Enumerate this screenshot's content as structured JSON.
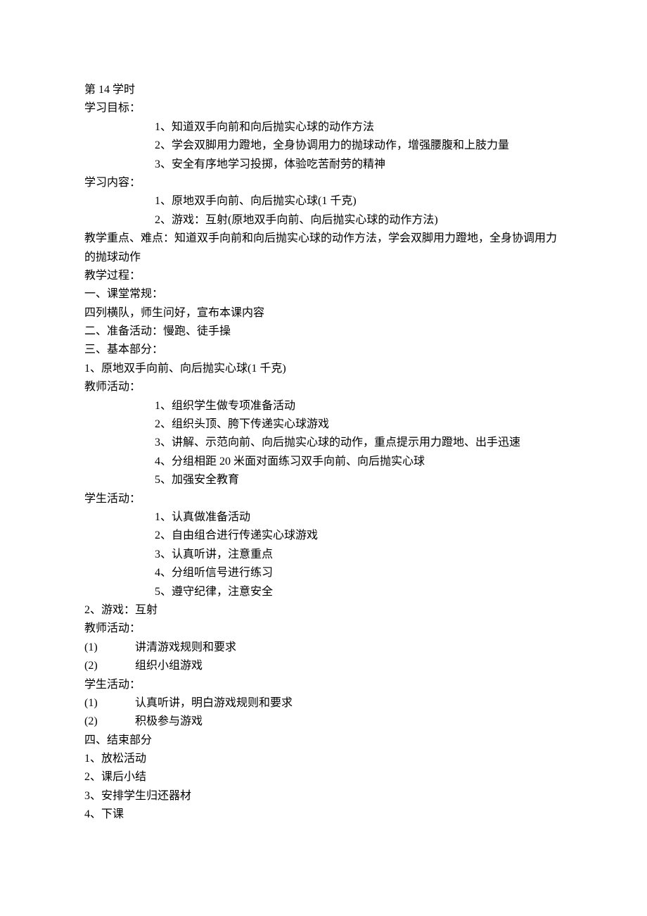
{
  "lesson_number": "第 14 学时",
  "goals_label": "学习目标：",
  "goals": [
    "1、知道双手向前和向后抛实心球的动作方法",
    "2、学会双脚用力蹬地，全身协调用力的抛球动作，增强腰腹和上肢力量",
    "3、安全有序地学习投掷，体验吃苦耐劳的精神"
  ],
  "content_label": "学习内容：",
  "content": [
    "1、原地双手向前、向后抛实心球(1 千克)",
    "2、游戏：互射(原地双手向前、向后抛实心球的动作方法)"
  ],
  "key_points": "教学重点、难点：知道双手向前和向后抛实心球的动作方法，学会双脚用力蹬地，全身协调用力的抛球动作",
  "process_label": "教学过程：",
  "section1_label": "一、课堂常规：",
  "section1_text": "四列横队，师生问好，宣布本课内容",
  "section2_label": "二、准备活动：慢跑、徒手操",
  "section3_label": "三、基本部分：",
  "part1_label": "1、原地双手向前、向后抛实心球(1 千克)",
  "teacher_act_label": "教师活动：",
  "teacher_acts1": [
    "1、组织学生做专项准备活动",
    "2、组织头顶、胯下传递实心球游戏",
    "3、讲解、示范向前、向后抛实心球的动作，重点提示用力蹬地、出手迅速",
    "4、分组相距 20 米面对面练习双手向前、向后抛实心球",
    "5、加强安全教育"
  ],
  "student_act_label": "学生活动：",
  "student_acts1": [
    "1、认真做准备活动",
    "2、自由组合进行传递实心球游戏",
    "3、认真听讲，注意重点",
    "4、分组听信号进行练习",
    "5、遵守纪律，注意安全"
  ],
  "part2_label": "2、游戏：互射",
  "teacher_acts2": [
    {
      "num": "(1)",
      "text": "讲清游戏规则和要求"
    },
    {
      "num": "(2)",
      "text": "组织小组游戏"
    }
  ],
  "student_acts2": [
    {
      "num": "(1)",
      "text": "认真听讲，明白游戏规则和要求"
    },
    {
      "num": "(2)",
      "text": "积极参与游戏"
    }
  ],
  "section4_label": "四、结束部分",
  "ending": [
    "1、放松活动",
    "2、课后小结",
    "3、安排学生归还器材",
    "4、下课"
  ]
}
